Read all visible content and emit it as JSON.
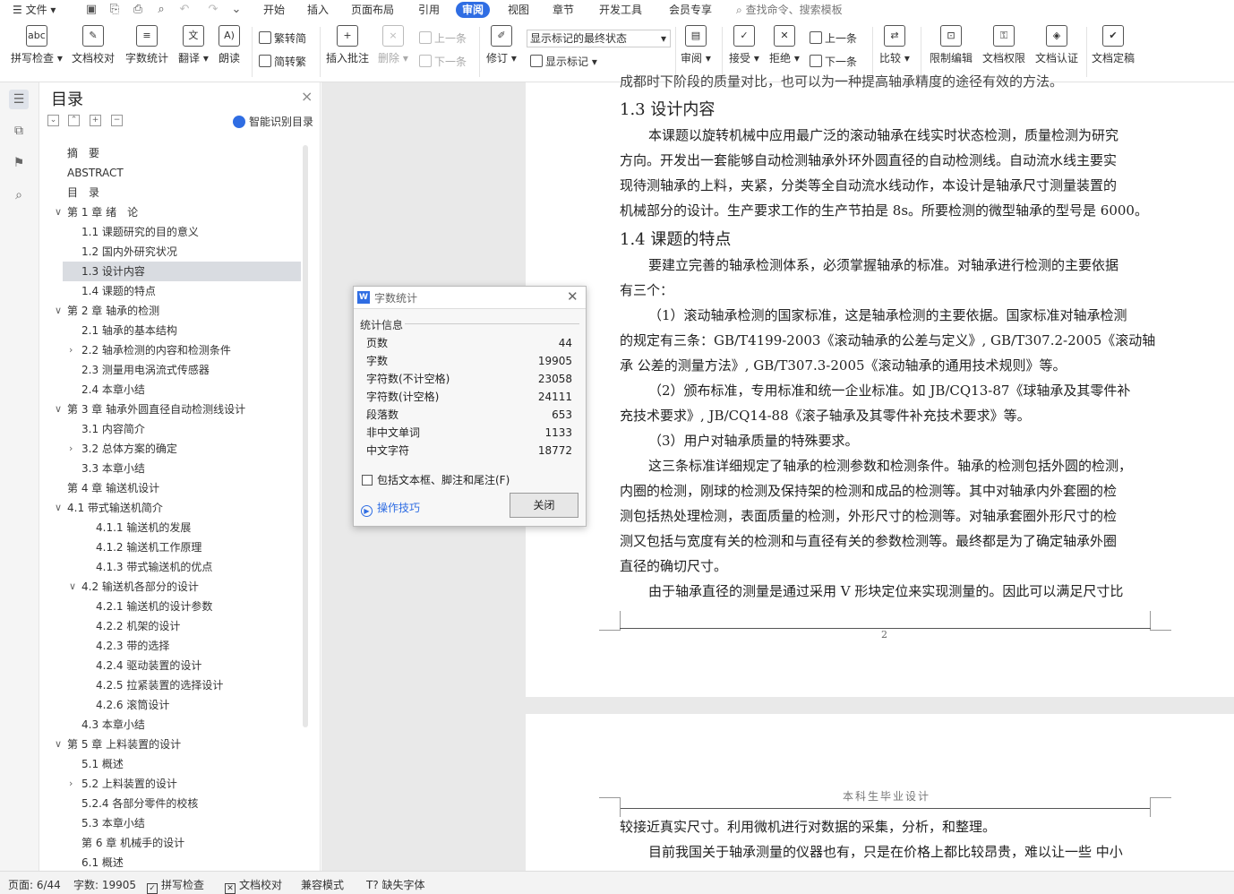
{
  "menubar": {
    "menu_label": "文件",
    "tabs": [
      "开始",
      "插入",
      "页面布局",
      "引用",
      "审阅",
      "视图",
      "章节",
      "开发工具",
      "会员专享"
    ],
    "active_tab": "审阅",
    "search_placeholder": "查找命令、搜索模板"
  },
  "ribbon": {
    "spell_check": "拼写检查",
    "doc_proof": "文档校对",
    "word_count": "字数统计",
    "translate": "翻译",
    "read_aloud": "朗读",
    "trad_to_simp": "繁转简",
    "simp_to_trad": "简转繁",
    "insert_comment": "插入批注",
    "delete": "删除",
    "prev": "上一条",
    "next": "下一条",
    "revise": "修订",
    "display_mode": "显示标记的最终状态",
    "show_markup": "显示标记",
    "review": "审阅",
    "accept": "接受",
    "reject": "拒绝",
    "prev2": "上一条",
    "next2": "下一条",
    "compare": "比较",
    "restrict_edit": "限制编辑",
    "doc_permission": "文档权限",
    "doc_auth": "文档认证",
    "doc_finalize": "文档定稿"
  },
  "toc": {
    "title": "目录",
    "smart_label": "智能识别目录",
    "items": [
      {
        "label": "摘　要"
      },
      {
        "label": "ABSTRACT"
      },
      {
        "label": "目　录"
      },
      {
        "label": "第 1 章  绪　论",
        "toggle": "∨"
      },
      {
        "label": "1.1 课题研究的目的意义"
      },
      {
        "label": "1.2 国内外研究状况"
      },
      {
        "label": "1.3 设计内容"
      },
      {
        "label": "1.4 课题的特点"
      },
      {
        "label": "第 2 章  轴承的检测",
        "toggle": "∨"
      },
      {
        "label": "2.1  轴承的基本结构"
      },
      {
        "label": "2.2  轴承检测的内容和检测条件",
        "toggle": "›"
      },
      {
        "label": "2.3  测量用电涡流式传感器"
      },
      {
        "label": "2.4 本章小结"
      },
      {
        "label": "第 3 章  轴承外圆直径自动检测线设计",
        "toggle": "∨"
      },
      {
        "label": "3.1  内容简介"
      },
      {
        "label": "3.2 总体方案的确定",
        "toggle": "›"
      },
      {
        "label": "3.3 本章小结"
      },
      {
        "label": "第 4 章  输送机设计"
      },
      {
        "label": "4.1  带式输送机简介",
        "toggle": "∨"
      },
      {
        "label": "4.1.1 输送机的发展"
      },
      {
        "label": "4.1.2 输送机工作原理"
      },
      {
        "label": "4.1.3 带式输送机的优点"
      },
      {
        "label": "4.2  输送机各部分的设计",
        "toggle": "∨"
      },
      {
        "label": "4.2.1 输送机的设计参数"
      },
      {
        "label": "4.2.2 机架的设计"
      },
      {
        "label": "4.2.3  带的选择"
      },
      {
        "label": "4.2.4  驱动装置的设计"
      },
      {
        "label": "4.2.5  拉紧装置的选择设计"
      },
      {
        "label": "4.2.6 滚筒设计"
      },
      {
        "label": "4.3 本章小结"
      },
      {
        "label": "第 5 章  上料装置的设计",
        "toggle": "∨"
      },
      {
        "label": "5.1  概述"
      },
      {
        "label": "5.2  上料装置的设计",
        "toggle": "›"
      },
      {
        "label": "5.2.4 各部分零件的校核"
      },
      {
        "label": "5.3 本章小结"
      },
      {
        "label": "第 6 章  机械手的设计"
      },
      {
        "label": "6.1  概述"
      }
    ]
  },
  "document": {
    "top_cut_line": "成都时下阶段的质量对比，也可以为一种提高轴承精度的途径有效的方法。",
    "h_13": "1.3 设计内容",
    "p1": [
      "本课题以旋转机械中应用最广泛的滚动轴承在线实时状态检测，质量检测为研究",
      "方向。开发出一套能够自动检测轴承外环外圆直径的自动检测线。自动流水线主要实",
      "现待测轴承的上料，夹紧，分类等全自动流水线动作，本设计是轴承尺寸测量装置的",
      "机械部分的设计。生产要求工作的生产节拍是 8s。所要检测的微型轴承的型号是 6000。"
    ],
    "h_14": "1.4 课题的特点",
    "p2": [
      "要建立完善的轴承检测体系，必须掌握轴承的标准。对轴承进行检测的主要依据",
      "有三个："
    ],
    "p3": [
      "（1）滚动轴承检测的国家标准，这是轴承检测的主要依据。国家标准对轴承检测",
      "的规定有三条：GB/T4199-2003《滚动轴承的公差与定义》, GB/T307.2-2005《滚动轴",
      "承  公差的测量方法》, GB/T307.3-2005《滚动轴承的通用技术规则》等。"
    ],
    "p4": [
      "（2）颁布标准，专用标准和统一企业标准。如 JB/CQ13-87《球轴承及其零件补",
      "充技术要求》, JB/CQ14-88《滚子轴承及其零件补充技术要求》等。"
    ],
    "p5": "（3）用户对轴承质量的特殊要求。",
    "p6": [
      "这三条标准详细规定了轴承的检测参数和检测条件。轴承的检测包括外圆的检测，",
      "内圈的检测，刚球的检测及保持架的检测和成品的检测等。其中对轴承内外套圈的检",
      "测包括热处理检测，表面质量的检测，外形尺寸的检测等。对轴承套圈外形尺寸的检",
      "测又包括与宽度有关的检测和与直径有关的参数检测等。最终都是为了确定轴承外圈",
      "直径的确切尺寸。"
    ],
    "p7": "由于轴承直径的测量是通过采用 V 形块定位来实现测量的。因此可以满足尺寸比",
    "page_number": "2",
    "header2": "本科生毕业设计",
    "p8": "较接近真实尺寸。利用微机进行对数据的采集，分析，和整理。",
    "p9": "目前我国关于轴承测量的仪器也有，只是在价格上都比较昂贵，难以让一些  中小"
  },
  "dialog": {
    "title": "字数统计",
    "group_label": "统计信息",
    "stats": [
      {
        "label": "页数",
        "value": "44"
      },
      {
        "label": "字数",
        "value": "19905"
      },
      {
        "label": "字符数(不计空格)",
        "value": "23058"
      },
      {
        "label": "字符数(计空格)",
        "value": "24111"
      },
      {
        "label": "段落数",
        "value": "653"
      },
      {
        "label": "非中文单词",
        "value": "1133"
      },
      {
        "label": "中文字符",
        "value": "18772"
      }
    ],
    "checkbox_label": "包括文本框、脚注和尾注(F)",
    "tips_label": "操作技巧",
    "close_label": "关闭"
  },
  "status": {
    "page": "页面: 6/44",
    "words": "字数: 19905",
    "spell": "拼写检查",
    "proof": "文档校对",
    "compat": "兼容模式",
    "missing_font": "缺失字体"
  }
}
